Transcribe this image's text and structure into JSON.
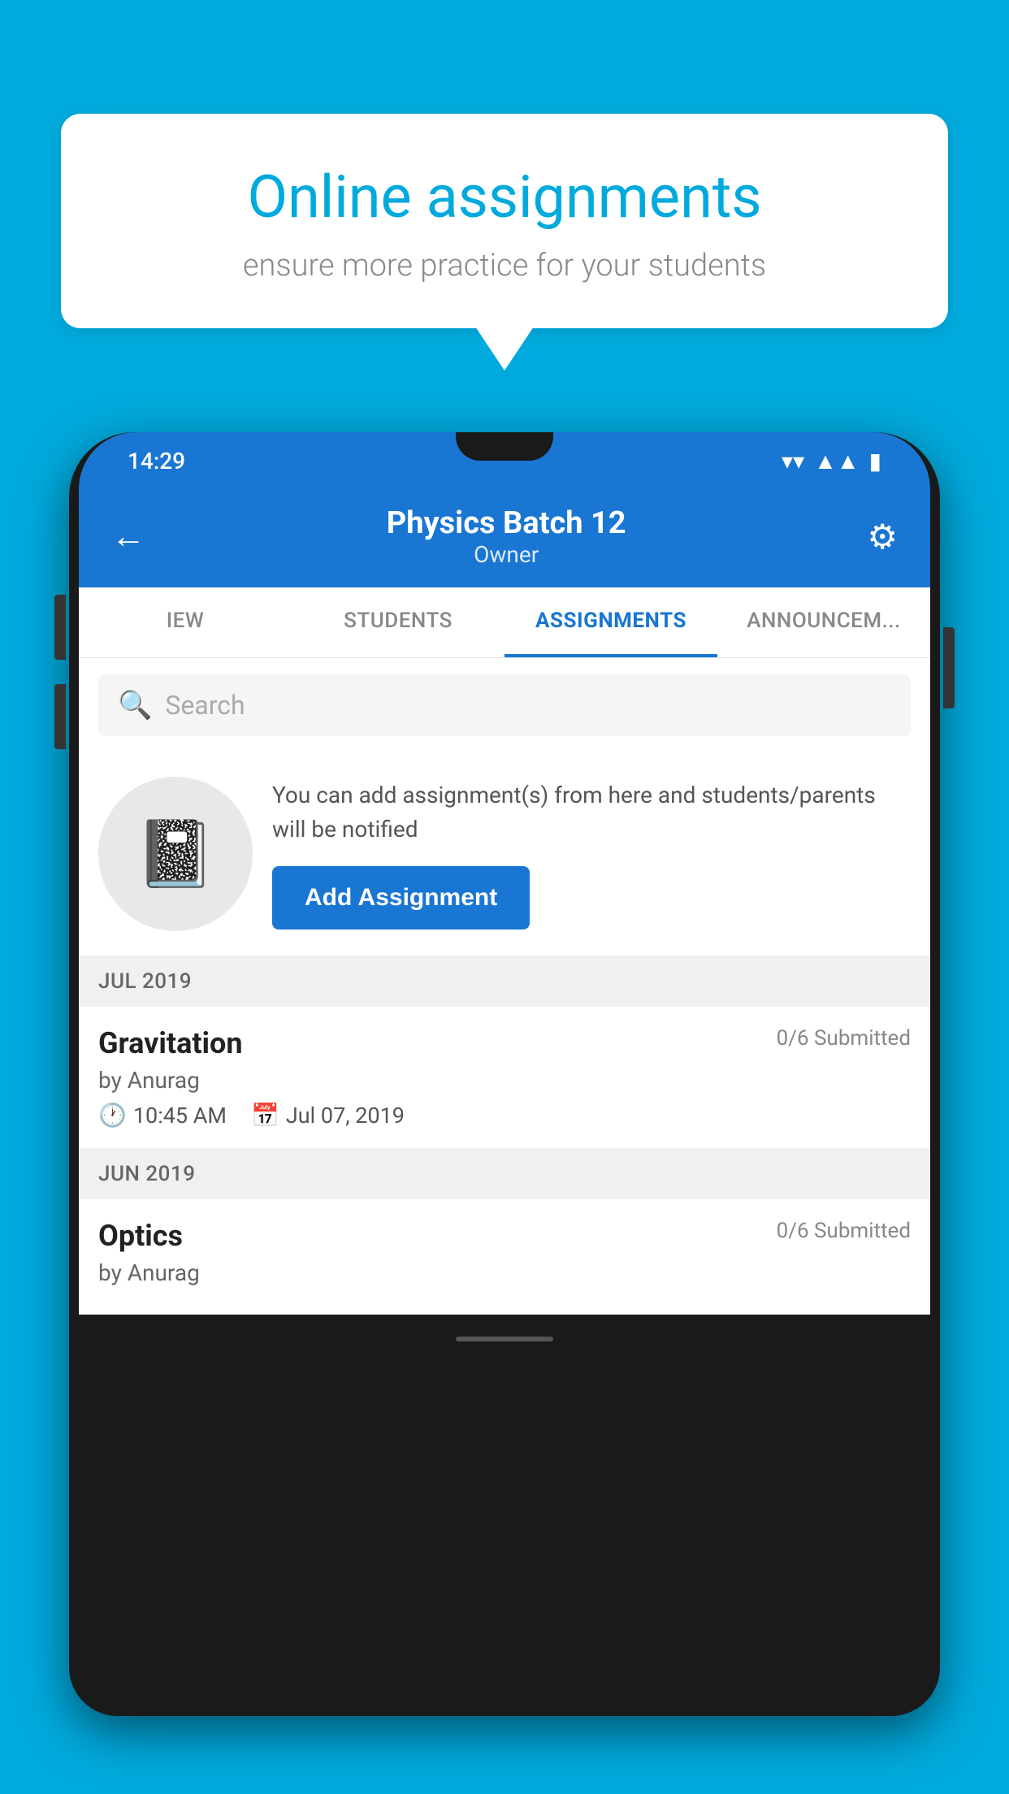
{
  "background_color": "#00AADD",
  "speech_bubble": {
    "title": "Online assignments",
    "subtitle": "ensure more practice for your students"
  },
  "status_bar": {
    "time": "14:29",
    "icons": [
      "wifi",
      "signal",
      "battery"
    ]
  },
  "header": {
    "title": "Physics Batch 12",
    "subtitle": "Owner",
    "back_label": "←",
    "gear_label": "⚙"
  },
  "tabs": [
    {
      "label": "IEW",
      "active": false
    },
    {
      "label": "STUDENTS",
      "active": false
    },
    {
      "label": "ASSIGNMENTS",
      "active": true
    },
    {
      "label": "ANNOUNCEM...",
      "active": false
    }
  ],
  "search": {
    "placeholder": "Search"
  },
  "promo": {
    "text": "You can add assignment(s) from here and students/parents will be notified",
    "button_label": "Add Assignment"
  },
  "sections": [
    {
      "header": "JUL 2019",
      "items": [
        {
          "name": "Gravitation",
          "submitted": "0/6 Submitted",
          "by": "by Anurag",
          "time": "10:45 AM",
          "date": "Jul 07, 2019"
        }
      ]
    },
    {
      "header": "JUN 2019",
      "items": [
        {
          "name": "Optics",
          "submitted": "0/6 Submitted",
          "by": "by Anurag",
          "time": "",
          "date": ""
        }
      ]
    }
  ]
}
